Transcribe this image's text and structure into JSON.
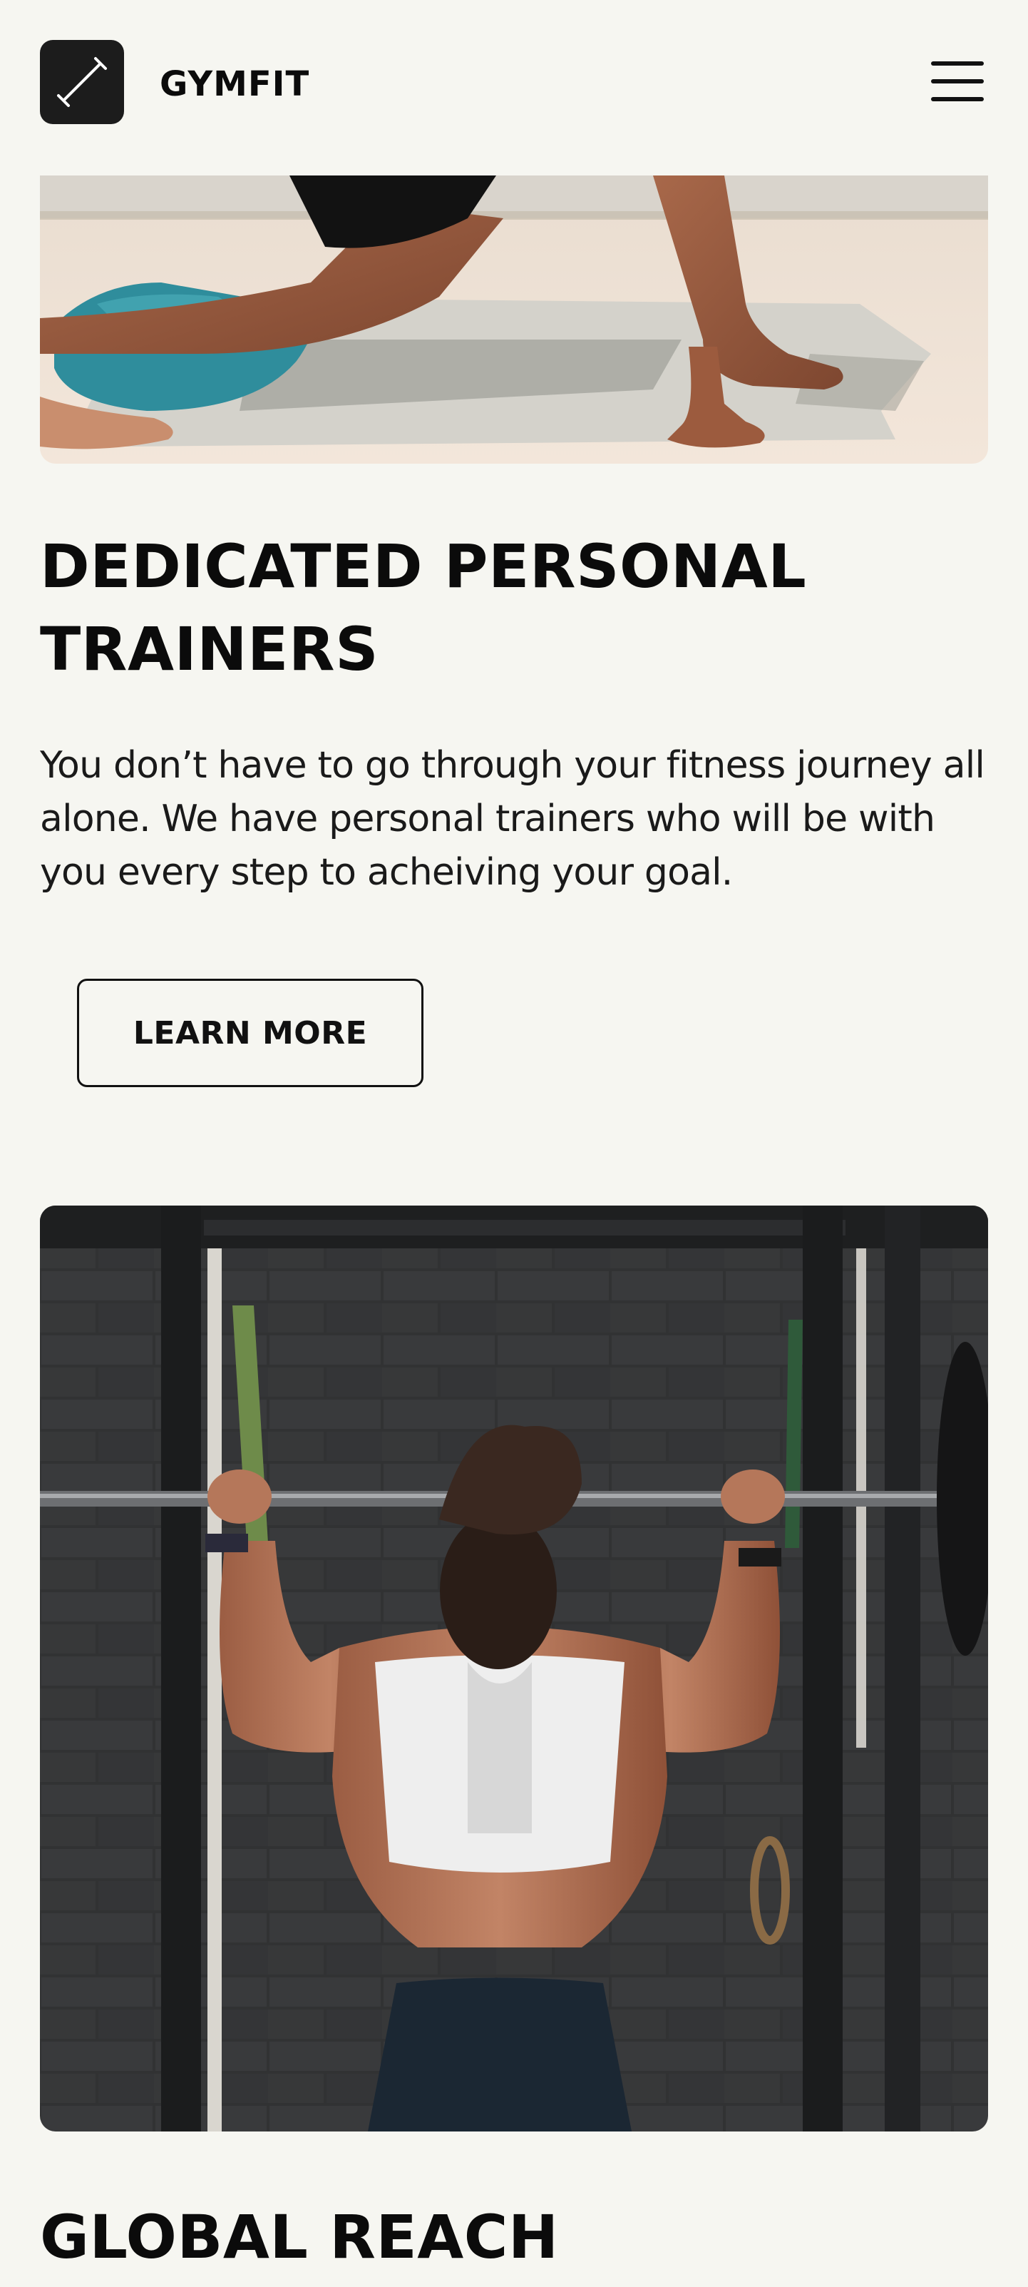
{
  "header": {
    "brand": "GYMFIT",
    "logo_icon": "dumbbell-diagonal-icon",
    "menu_icon": "hamburger-menu-icon"
  },
  "sections": [
    {
      "image_alt": "person stretching on a mat",
      "title": "DEDICATED PERSONAL TRAINERS",
      "body": "You don’t have to go through your fitness journey all alone. We have personal trainers who will be with you every step to acheiving your goal.",
      "button_label": "LEARN MORE"
    },
    {
      "image_alt": "woman lifting a barbell in a gym",
      "title": "GLOBAL REACH"
    }
  ],
  "colors": {
    "background": "#f6f6f1",
    "text": "#0b0b0b",
    "logo_bg": "#1c1c1c"
  }
}
